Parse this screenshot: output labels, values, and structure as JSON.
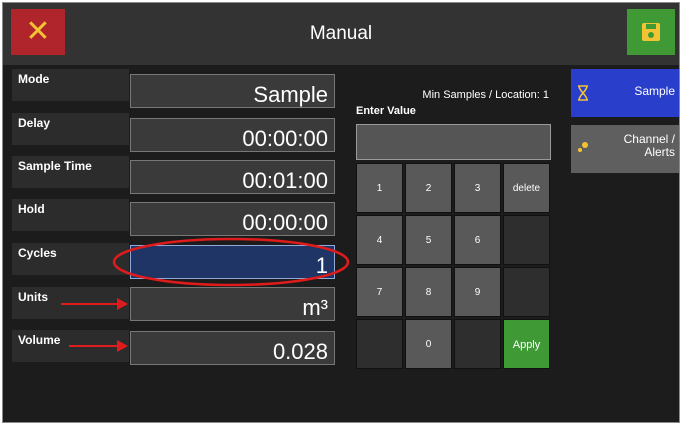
{
  "window": {
    "title": "Manual"
  },
  "toolbar": {
    "close_icon": "close-x-icon",
    "close_glyph": "✕",
    "save_icon": "save-floppy-icon",
    "close_color": "#b0242b",
    "save_color": "#3f9a35"
  },
  "params": [
    {
      "label": "Mode",
      "value": "Sample"
    },
    {
      "label": "Delay",
      "value": "00:00:00"
    },
    {
      "label": "Sample Time",
      "value": "00:01:00"
    },
    {
      "label": "Hold",
      "value": "00:00:00"
    },
    {
      "label": "Cycles",
      "value": "1",
      "active": true
    },
    {
      "label": "Units",
      "value": "m³"
    },
    {
      "label": "Volume",
      "value": "0.028"
    }
  ],
  "keypad": {
    "min_samples_text": "Min Samples / Location: 1",
    "enter_label": "Enter Value",
    "entry_value": "",
    "keys": [
      "1",
      "2",
      "3",
      "delete",
      "4",
      "5",
      "6",
      "",
      "7",
      "8",
      "9",
      "",
      "",
      "0",
      "",
      "Apply"
    ],
    "apply_color": "#3f9a35"
  },
  "sidebar": {
    "items": [
      {
        "label": "Sample",
        "icon": "hourglass-icon",
        "selected": true
      },
      {
        "label_line1": "Channel /",
        "label_line2": "Alerts",
        "icon": "channel-dots-icon",
        "selected": false
      }
    ],
    "selected_color": "#2a3ecc"
  },
  "annotations": {
    "highlight_color": "#e01b1b"
  }
}
